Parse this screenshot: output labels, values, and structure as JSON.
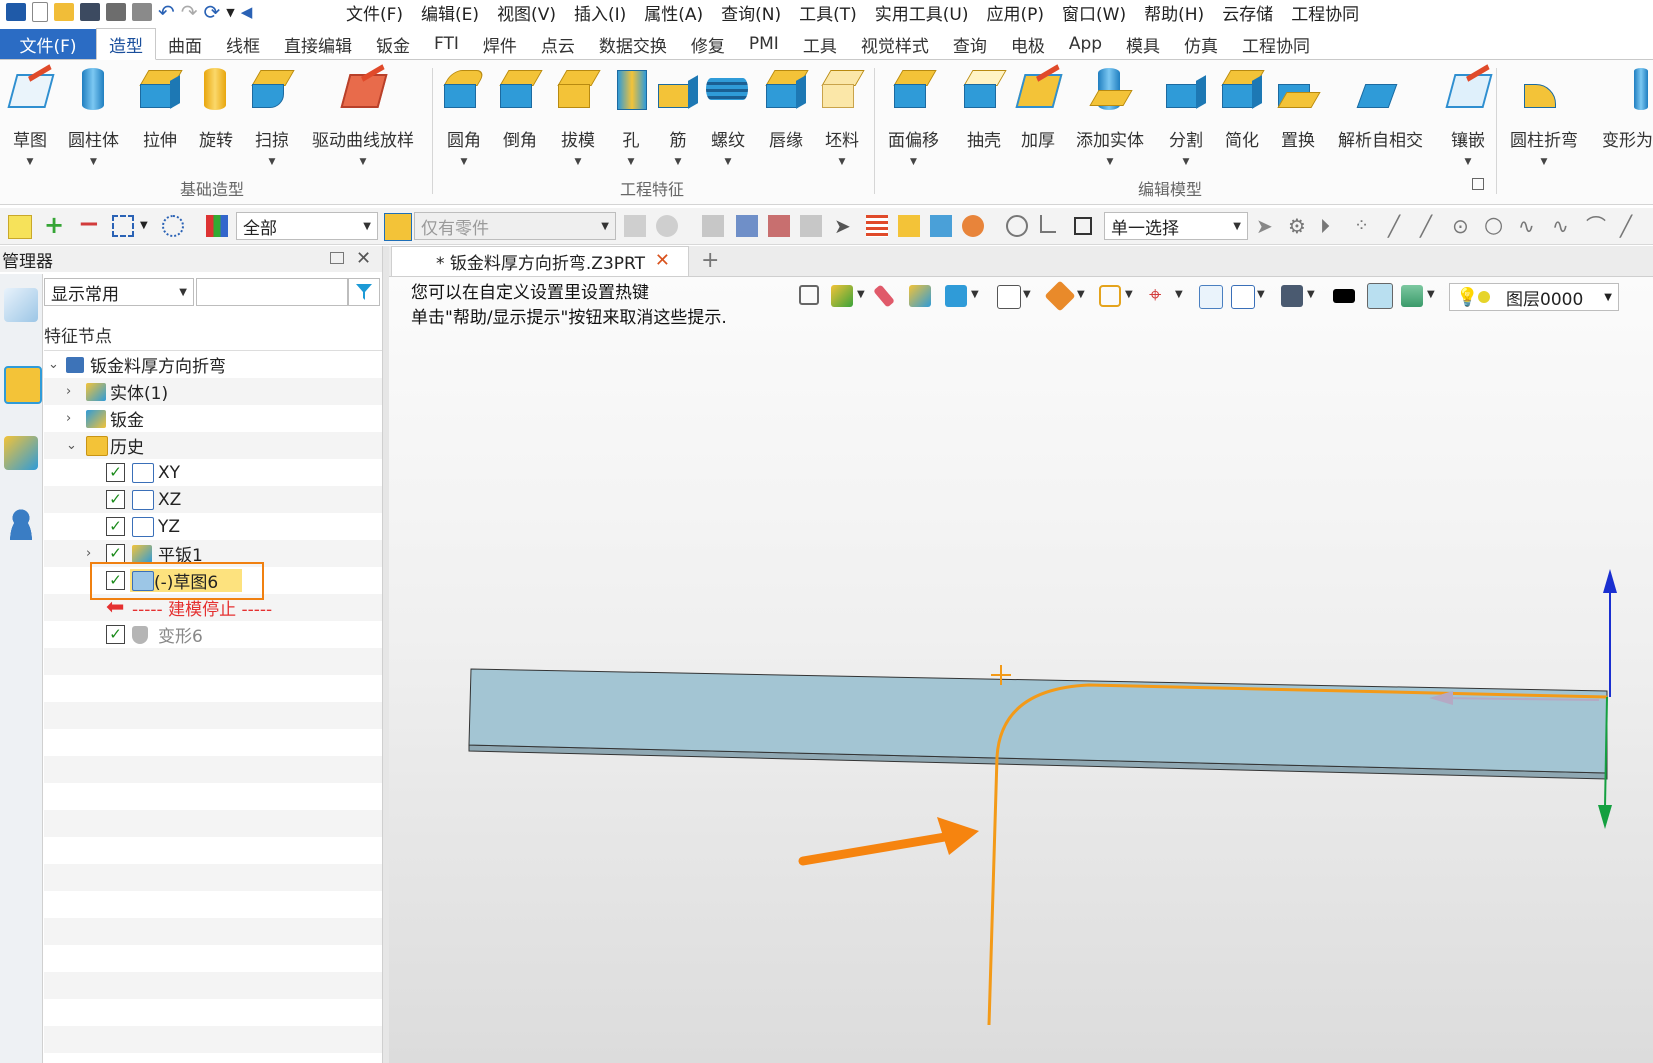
{
  "menubar": {
    "items": [
      "文件(F)",
      "编辑(E)",
      "视图(V)",
      "插入(I)",
      "属性(A)",
      "查询(N)",
      "工具(T)",
      "实用工具(U)",
      "应用(P)",
      "窗口(W)",
      "帮助(H)",
      "云存储",
      "工程协同"
    ]
  },
  "ribbon_tabs": {
    "file": "文件(F)",
    "items": [
      "造型",
      "曲面",
      "线框",
      "直接编辑",
      "钣金",
      "FTI",
      "焊件",
      "点云",
      "数据交换",
      "修复",
      "PMI",
      "工具",
      "视觉样式",
      "查询",
      "电极",
      "App",
      "模具",
      "仿真",
      "工程协同"
    ],
    "active": "造型"
  },
  "ribbon": {
    "tools": [
      "草图",
      "圆柱体",
      "拉伸",
      "旋转",
      "扫掠",
      "驱动曲线放样",
      "圆角",
      "倒角",
      "拔模",
      "孔",
      "筋",
      "螺纹",
      "唇缘",
      "坯料",
      "面偏移",
      "抽壳",
      "加厚",
      "添加实体",
      "分割",
      "简化",
      "置换",
      "解析自相交",
      "镶嵌",
      "圆柱折弯",
      "变形为"
    ],
    "groups": [
      "基础造型",
      "工程特征",
      "编辑模型"
    ]
  },
  "toolbar": {
    "filter_value": "全部",
    "scope_value": "仅有零件",
    "select_mode": "单一选择"
  },
  "manager": {
    "title": "管理器",
    "display_filter": "显示常用",
    "tree_header": "特征节点",
    "tree": {
      "root": "钣金料厚方向折弯",
      "solid": "实体(1)",
      "sheetmetal": "钣金",
      "history": "历史",
      "xy": "XY",
      "xz": "XZ",
      "yz": "YZ",
      "flat": "平钣1",
      "sketch": "(-)草图6",
      "stop": "----- 建模停止 -----",
      "deform": "变形6"
    }
  },
  "document": {
    "tab_title": "* 钣金料厚方向折弯.Z3PRT",
    "hint_line1": "您可以在自定义设置里设置热键",
    "hint_line2": "单击\"帮助/显示提示\"按钮来取消这些提示.",
    "layer": "图层0000"
  },
  "colors": {
    "accent": "#2b6cc4",
    "highlight": "#f08010",
    "plate": "#a3c5d3",
    "sketch": "#f39a18",
    "stop_marker": "#e53030"
  }
}
